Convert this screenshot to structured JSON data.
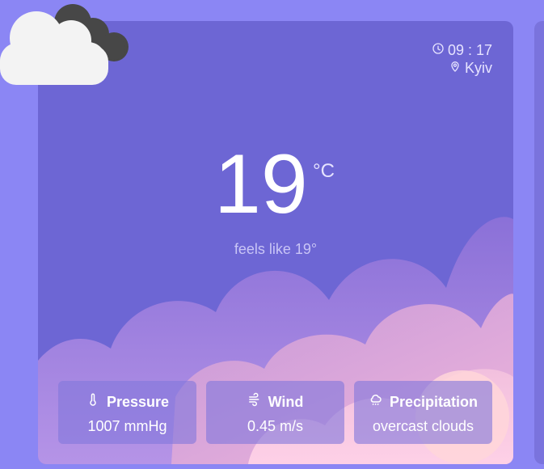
{
  "location": {
    "time": "09 : 17",
    "city": "Kyiv"
  },
  "current": {
    "temperature": "19",
    "unit": "°C",
    "feels_like": "feels like  19°"
  },
  "details": [
    {
      "icon": "thermometer-icon",
      "label": "Pressure",
      "value": "1007 mmHg"
    },
    {
      "icon": "wind-icon",
      "label": "Wind",
      "value": "0.45 m/s"
    },
    {
      "icon": "rain-cloud-icon",
      "label": "Precipitation",
      "value": "overcast clouds"
    }
  ],
  "weather_icon": "overcast-clouds-icon",
  "colors": {
    "page_bg": "#8b86f4",
    "card_bg": "#6d66d4",
    "text": "#ffffff",
    "muted_text": "#c9c5f6"
  }
}
